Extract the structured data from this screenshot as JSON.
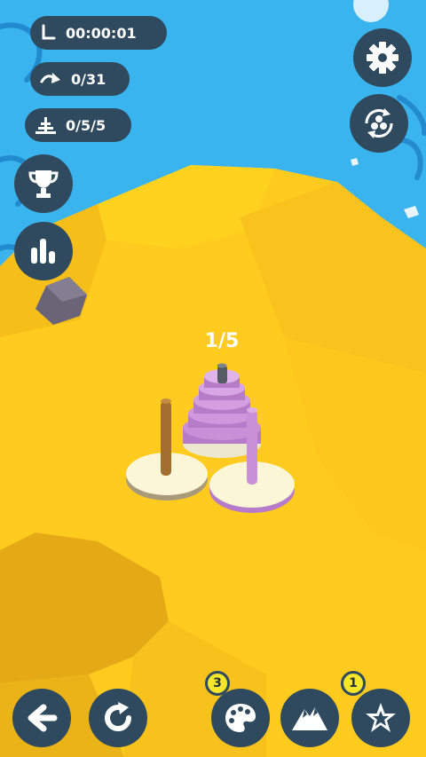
{
  "hud": {
    "timer": "00:00:01",
    "moves": "0/31",
    "progress": "0/5/5"
  },
  "level_indicator": "1/5",
  "badges": {
    "palette_count": "3",
    "star_count": "1"
  },
  "colors": {
    "sky": "#3ab4ef",
    "sand": "#ffcb1f",
    "hud_bg": "#2f4a5f",
    "badge": "#f6e629",
    "disk": "#c890d6"
  },
  "icons": {
    "timer": "timer-icon",
    "moves": "moves-icon",
    "progress": "stack-icon",
    "settings": "gear-icon",
    "camera": "rotate-camera-icon",
    "trophy": "trophy-icon",
    "stats": "bar-chart-icon",
    "back": "arrow-left-icon",
    "restart": "restart-icon",
    "palette": "palette-icon",
    "mountain": "mountain-icon",
    "star": "star-icon"
  }
}
